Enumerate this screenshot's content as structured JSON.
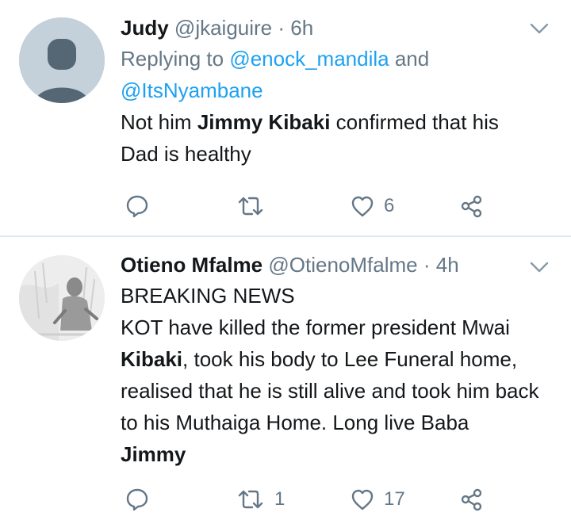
{
  "tweets": [
    {
      "name": "Judy",
      "handle": "@jkaiguire",
      "separator": "·",
      "time": "6h",
      "reply_prefix": "Replying to",
      "reply_to_1": "@enock_mandila",
      "reply_and": "and",
      "reply_to_2": "@ItsNyambane",
      "text": {
        "p1": "Not him ",
        "b1": "Jimmy Kibaki",
        "p2": " confirmed that his Dad is healthy"
      },
      "replies": "",
      "retweets": "",
      "likes": "6"
    },
    {
      "name": "Otieno Mfalme",
      "handle": "@OtienoMfalme",
      "separator": "·",
      "time": "4h",
      "text": {
        "line1": "BREAKING NEWS",
        "p1": "KOT have killed the former president Mwai ",
        "b1": "Kibaki",
        "p2": ", took his body to Lee Funeral home, realised that he is still alive and took him back to his Muthaiga Home. Long live Baba ",
        "b2": "Jimmy"
      },
      "replies": "",
      "retweets": "1",
      "likes": "17"
    }
  ],
  "icons": {
    "reply": "reply-icon",
    "retweet": "retweet-icon",
    "like": "heart-icon",
    "share": "share-icon",
    "caret": "chevron-down-icon"
  },
  "colors": {
    "text": "#14171a",
    "secondary": "#657786",
    "link": "#1da1f2",
    "divider": "#e1e8ed"
  }
}
